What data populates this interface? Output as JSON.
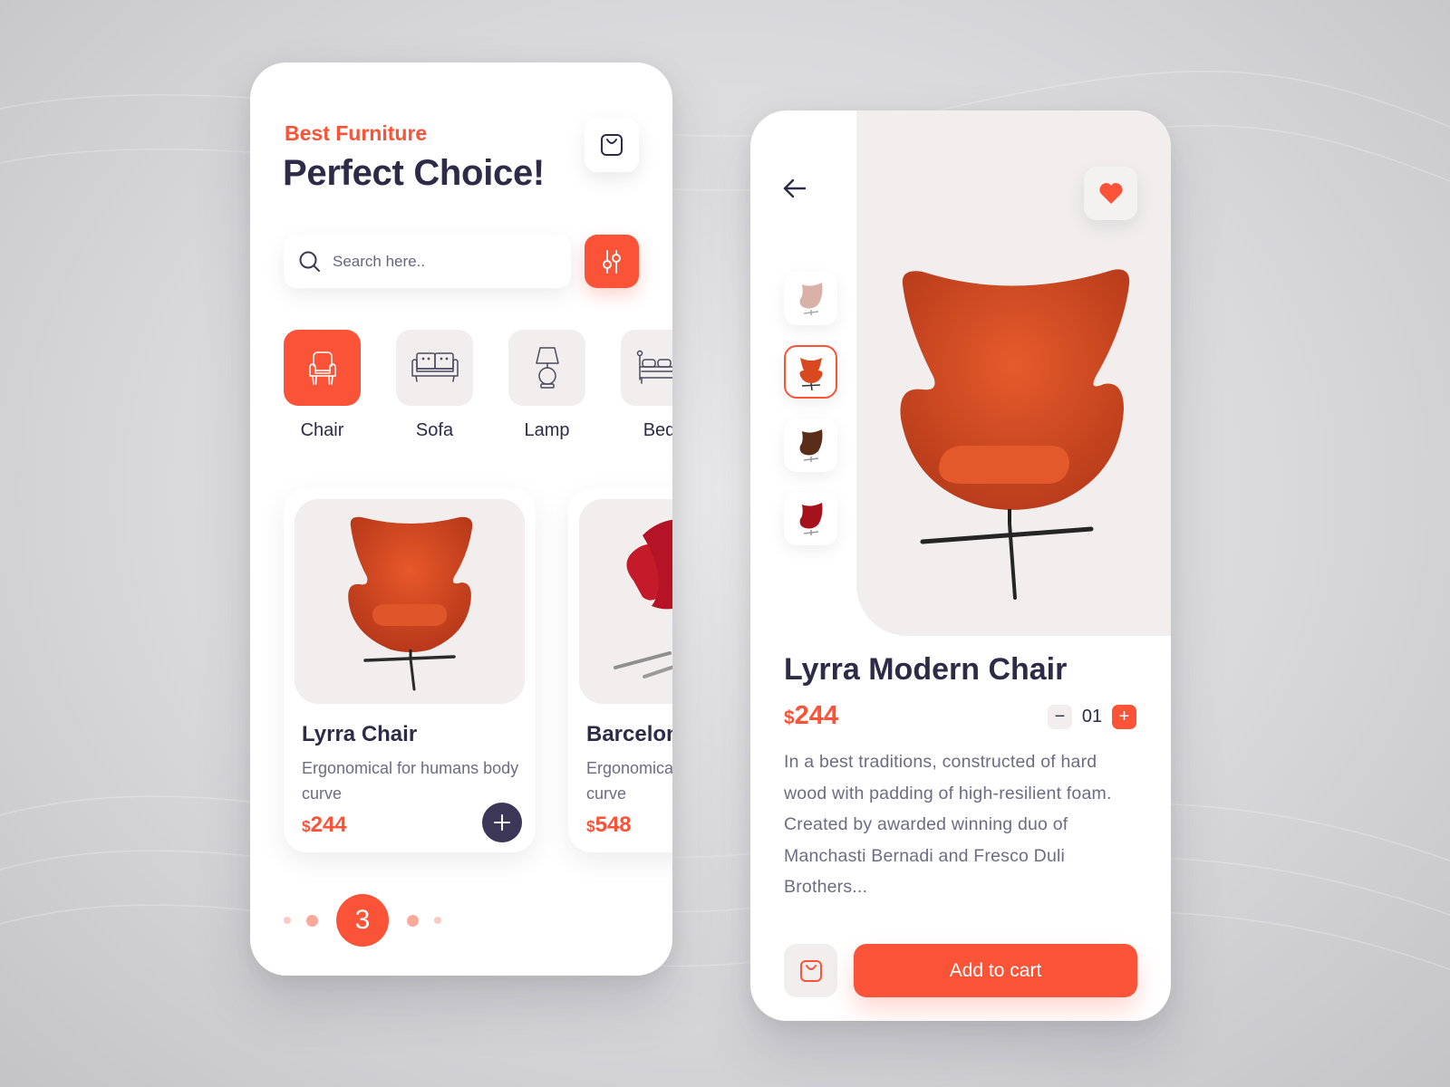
{
  "colors": {
    "accent": "#fa5337",
    "dark": "#2d2b48",
    "muted": "#6d6c82",
    "tile": "#f1eeed",
    "add_button": "#3c3756"
  },
  "home": {
    "subtitle": "Best Furniture",
    "title": "Perfect Choice!",
    "cart_icon": "shopping-bag-icon",
    "search": {
      "placeholder": "Search here..",
      "value": "",
      "icon": "search-icon"
    },
    "filter_icon": "sliders-icon",
    "categories": [
      {
        "label": "Chair",
        "icon": "armchair-icon",
        "active": true
      },
      {
        "label": "Sofa",
        "icon": "sofa-icon",
        "active": false
      },
      {
        "label": "Lamp",
        "icon": "lamp-icon",
        "active": false
      },
      {
        "label": "Bed",
        "icon": "bed-icon",
        "active": false
      }
    ],
    "products": [
      {
        "name": "Lyrra Chair",
        "description": "Ergonomical for humans body curve",
        "currency": "$",
        "price": "244"
      },
      {
        "name": "Barcelona",
        "description": "Ergonomical for humans body curve",
        "currency": "$",
        "price": "548"
      }
    ],
    "pagination": {
      "current": "3"
    }
  },
  "detail": {
    "back_icon": "arrow-left-icon",
    "favorite_icon": "heart-icon",
    "thumbnails": [
      {
        "variant": "pink",
        "active": false
      },
      {
        "variant": "orange",
        "active": true
      },
      {
        "variant": "brown",
        "active": false
      },
      {
        "variant": "red",
        "active": false
      }
    ],
    "title": "Lyrra Modern Chair",
    "currency": "$",
    "price": "244",
    "quantity": "01",
    "minus_label": "−",
    "plus_label": "+",
    "description": "In a best traditions, constructed of hard wood with padding of high-resilient foam. Created by awarded winning duo of Manchasti Bernadi and Fresco Duli Brothers...",
    "add_to_cart_label": "Add to cart"
  }
}
